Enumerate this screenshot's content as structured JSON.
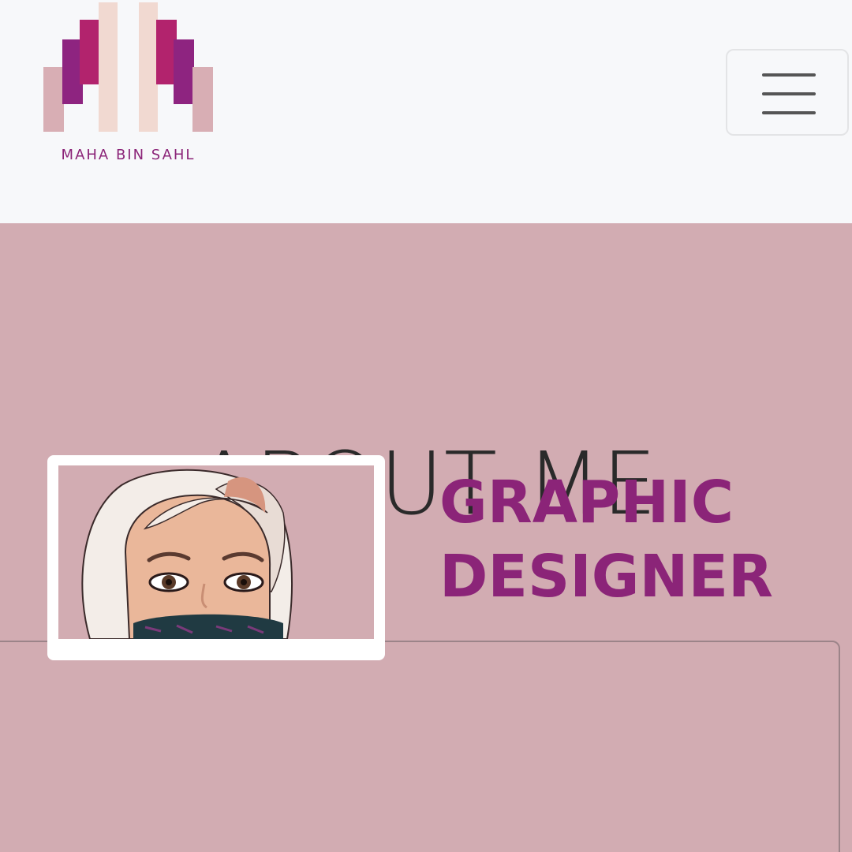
{
  "header": {
    "logo_text": "MAHA BIN SAHL",
    "menu_icon": "hamburger-icon"
  },
  "hero": {
    "title": "ABOUT ME"
  },
  "profile": {
    "role_line1": "GRAPHIC",
    "role_line2": "DESIGNER",
    "avatar_icon": "avatar-illustration"
  },
  "colors": {
    "page_bg": "#f7f8fa",
    "section_bg": "#d2acb2",
    "accent_purple": "#8b2478",
    "magenta": "#b2236d",
    "blush": "#f1d9d1",
    "dusty_pink": "#d8aeb4"
  }
}
